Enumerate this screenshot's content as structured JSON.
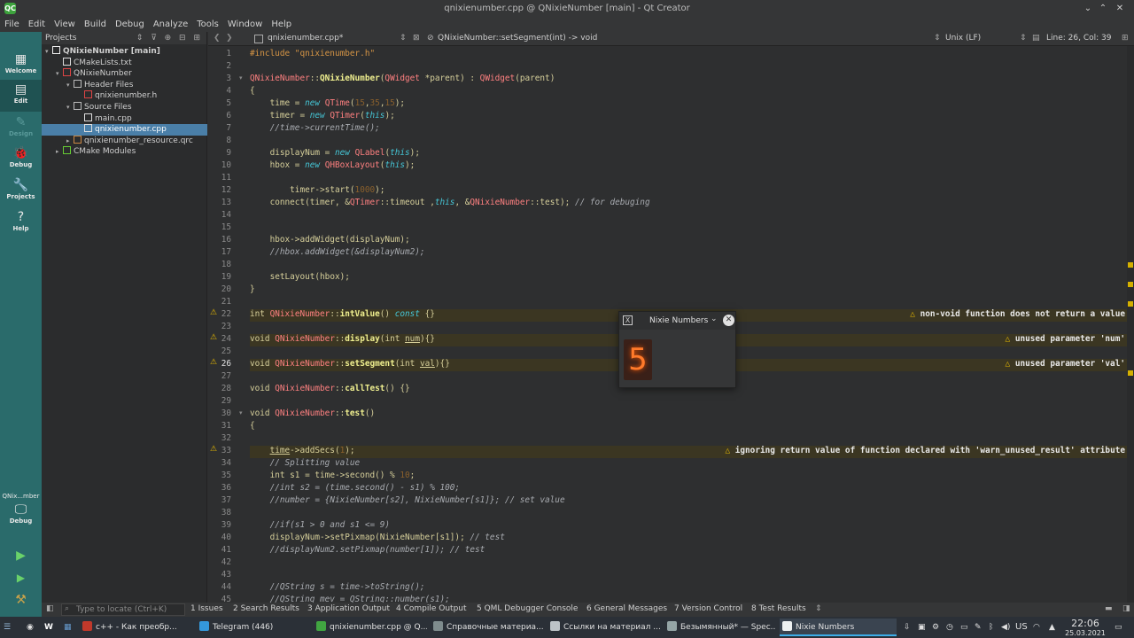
{
  "window": {
    "title": "qnixienumber.cpp @ QNixieNumber [main] - Qt Creator",
    "app_icon": "QC"
  },
  "menu": [
    "File",
    "Edit",
    "View",
    "Build",
    "Debug",
    "Analyze",
    "Tools",
    "Window",
    "Help"
  ],
  "modes": [
    {
      "label": "Welcome",
      "icon": "▦"
    },
    {
      "label": "Edit",
      "icon": "▤"
    },
    {
      "label": "Design",
      "icon": "✎"
    },
    {
      "label": "Debug",
      "icon": "🐞"
    },
    {
      "label": "Projects",
      "icon": "🔧"
    },
    {
      "label": "Help",
      "icon": "?"
    }
  ],
  "kit": {
    "name": "QNix...mber",
    "mode": "Debug"
  },
  "projects": {
    "header": "Projects",
    "tree": [
      {
        "label": "QNixieNumber [main]",
        "depth": 0,
        "arrow": "▾",
        "icon": "project"
      },
      {
        "label": "CMakeLists.txt",
        "depth": 1,
        "arrow": "",
        "icon": "file"
      },
      {
        "label": "QNixieNumber",
        "depth": 1,
        "arrow": "▾",
        "icon": "target"
      },
      {
        "label": "Header Files",
        "depth": 2,
        "arrow": "▾",
        "icon": "folder"
      },
      {
        "label": "qnixienumber.h",
        "depth": 3,
        "arrow": "",
        "icon": "header"
      },
      {
        "label": "Source Files",
        "depth": 2,
        "arrow": "▾",
        "icon": "folder"
      },
      {
        "label": "main.cpp",
        "depth": 3,
        "arrow": "",
        "icon": "file"
      },
      {
        "label": "qnixienumber.cpp",
        "depth": 3,
        "arrow": "",
        "icon": "file",
        "selected": true
      },
      {
        "label": "qnixienumber_resource.qrc",
        "depth": 2,
        "arrow": "▸",
        "icon": "qrc"
      },
      {
        "label": "CMake Modules",
        "depth": 1,
        "arrow": "▸",
        "icon": "cmake"
      }
    ]
  },
  "editor": {
    "file": "qnixienumber.cpp*",
    "symbol": "QNixieNumber::setSegment(int) -> void",
    "encoding": "Unix (LF)",
    "position": "Line: 26, Col: 39"
  },
  "code": [
    {
      "n": "1",
      "h": "<span class='p'>#include \"qnixienumber.h\"</span>"
    },
    {
      "n": "2",
      "h": ""
    },
    {
      "n": "3",
      "h": "<span class='t'>QNixieNumber</span>::<span class='f'>QNixieNumber</span>(<span class='t'>QWidget</span> *parent) : <span class='t'>QWidget</span>(parent)",
      "fold": true
    },
    {
      "n": "4",
      "h": "{"
    },
    {
      "n": "5",
      "h": "    <span class='fn'>time</span> = <span class='k'>new</span> <span class='t'>QTime</span>(<span class='n'>15</span>,<span class='n'>35</span>,<span class='n'>15</span>);"
    },
    {
      "n": "6",
      "h": "    <span class='fn'>timer</span> = <span class='k'>new</span> <span class='t'>QTimer</span>(<span class='k'>this</span>);"
    },
    {
      "n": "7",
      "h": "    <span class='c'>//time->currentTime();</span>"
    },
    {
      "n": "8",
      "h": ""
    },
    {
      "n": "9",
      "h": "    <span class='fn'>displayNum</span> = <span class='k'>new</span> <span class='t'>QLabel</span>(<span class='k'>this</span>);"
    },
    {
      "n": "10",
      "h": "    <span class='fn'>hbox</span> = <span class='k'>new</span> <span class='t'>QHBoxLayout</span>(<span class='k'>this</span>);"
    },
    {
      "n": "11",
      "h": ""
    },
    {
      "n": "12",
      "h": "        <span class='fn'>timer</span>->start(<span class='n'>1000</span>);"
    },
    {
      "n": "13",
      "h": "    connect(<span class='fn'>timer</span>, &<span class='t'>QTimer</span>::timeout ,<span class='k'>this</span>, &<span class='t'>QNixieNumber</span>::test); <span class='c'>// for debuging</span>"
    },
    {
      "n": "14",
      "h": ""
    },
    {
      "n": "15",
      "h": ""
    },
    {
      "n": "16",
      "h": "    <span class='fn'>hbox</span>->addWidget(<span class='fn'>displayNum</span>);"
    },
    {
      "n": "17",
      "h": "    <span class='c'>//hbox.addWidget(&displayNum2);</span>"
    },
    {
      "n": "18",
      "h": ""
    },
    {
      "n": "19",
      "h": "    setLayout(<span class='fn'>hbox</span>);"
    },
    {
      "n": "20",
      "h": "}"
    },
    {
      "n": "21",
      "h": ""
    },
    {
      "n": "22",
      "h": "<span class='sym'>int</span> <span class='t'>QNixieNumber</span>::<span class='f'>intValue</span>() <span class='k'>const</span> {}",
      "warn": "non-void function does not return a value"
    },
    {
      "n": "23",
      "h": ""
    },
    {
      "n": "24",
      "h": "<span class='sym'>void</span> <span class='t'>QNixieNumber</span>::<span class='f'>display</span>(<span class='sym'>int</span> <u>num</u>){}",
      "warn": "unused parameter 'num'"
    },
    {
      "n": "25",
      "h": ""
    },
    {
      "n": "26",
      "h": "<span class='sym'>void</span> <span class='t'>QNixieNumber</span>::<span class='f'>setSegment</span>(<span class='sym'>int</span> <u>val</u>){}",
      "warn": "unused parameter 'val'",
      "current": true
    },
    {
      "n": "27",
      "h": ""
    },
    {
      "n": "28",
      "h": "<span class='sym'>void</span> <span class='t'>QNixieNumber</span>::<span class='f'>callTest</span>() {}"
    },
    {
      "n": "29",
      "h": ""
    },
    {
      "n": "30",
      "h": "<span class='sym'>void</span> <span class='t'>QNixieNumber</span>::<span class='f'>test</span>()",
      "fold": true
    },
    {
      "n": "31",
      "h": "{"
    },
    {
      "n": "32",
      "h": ""
    },
    {
      "n": "33",
      "h": "    <u>time</u>->addSecs(<span class='n'>1</span>);",
      "warn": "ignoring return value of function declared with 'warn_unused_result' attribute"
    },
    {
      "n": "34",
      "h": "    <span class='c'>// Splitting value</span>"
    },
    {
      "n": "35",
      "h": "    <span class='sym'>int</span> s1 = <span class='fn'>time</span>->second() % <span class='n'>10</span>;"
    },
    {
      "n": "36",
      "h": "    <span class='c'>//int s2 = (time.second() - s1) % 100;</span>"
    },
    {
      "n": "37",
      "h": "    <span class='c'>//number = {NixieNumber[s2], NixieNumber[s1]}; // set value</span>"
    },
    {
      "n": "38",
      "h": ""
    },
    {
      "n": "39",
      "h": "    <span class='c'>//if(s1 > 0 and s1 <= 9)</span>"
    },
    {
      "n": "40",
      "h": "    <span class='fn'>displayNum</span>->setPixmap(NixieNumber[s1]); <span class='c'>// test</span>"
    },
    {
      "n": "41",
      "h": "    <span class='c'>//displayNum2.setPixmap(number[1]); // test</span>"
    },
    {
      "n": "42",
      "h": ""
    },
    {
      "n": "43",
      "h": ""
    },
    {
      "n": "44",
      "h": "    <span class='c'>//QString s = time->toString();</span>"
    },
    {
      "n": "45",
      "h": "    <span class='c'>//QString mev = QString::number(s1);</span>"
    }
  ],
  "nixie_window": {
    "title": "Nixie Numbers",
    "digit": "5"
  },
  "locator_placeholder": "Type to locate (Ctrl+K)",
  "output_tabs": [
    "1 Issues",
    "2 Search Results",
    "3 Application Output",
    "4 Compile Output",
    "5 QML Debugger Console",
    "6 General Messages",
    "7 Version Control",
    "8 Test Results"
  ],
  "taskbar": {
    "tasks": [
      {
        "label": "c++ - Как преобр...",
        "color": "#c0392b"
      },
      {
        "label": "Telegram (446)",
        "color": "#3498db"
      },
      {
        "label": "qnixienumber.cpp @ Q...",
        "color": "#41a541"
      },
      {
        "label": "Справочные материа...",
        "color": "#7f8c8d"
      },
      {
        "label": "Ссылки на материал ...",
        "color": "#bdc3c7"
      },
      {
        "label": "Безымянный* — Spec...",
        "color": "#95a5a6"
      },
      {
        "label": "Nixie Numbers",
        "color": "#ecf0f1",
        "active": true
      }
    ],
    "keyboard": "US",
    "time": "22:06",
    "date": "25.03.2021"
  },
  "colors": {
    "accent": "#2a6b6b",
    "selection": "#4a7fa8",
    "warning": "#e6b800",
    "nixie_glow": "#ff7a2a"
  }
}
